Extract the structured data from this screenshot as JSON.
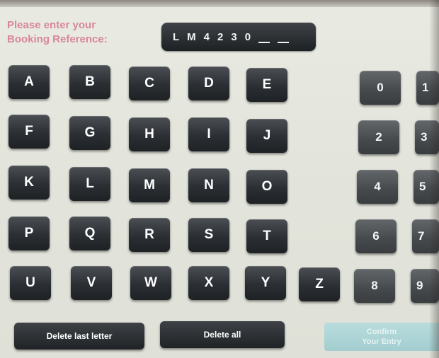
{
  "prompt": {
    "line1": "Please enter your",
    "line2": "Booking Reference:"
  },
  "reference": {
    "chars": [
      "L",
      "M",
      "4",
      "2",
      "3",
      "0"
    ],
    "remaining_blanks": 2
  },
  "letters": [
    [
      "A",
      "B",
      "C",
      "D",
      "E"
    ],
    [
      "F",
      "G",
      "H",
      "I",
      "J"
    ],
    [
      "K",
      "L",
      "M",
      "N",
      "O"
    ],
    [
      "P",
      "Q",
      "R",
      "S",
      "T"
    ],
    [
      "U",
      "V",
      "W",
      "X",
      "Y",
      "Z"
    ]
  ],
  "digits": {
    "left_column": [
      "0",
      "2",
      "4",
      "6",
      "8"
    ],
    "right_column_partial": [
      "1",
      "3",
      "5",
      "7",
      "9"
    ]
  },
  "actions": {
    "delete_last": "Delete last letter",
    "delete_all": "Delete all",
    "confirm_line1": "Confirm",
    "confirm_line2": "Your Entry"
  },
  "colors": {
    "prompt_text": "#d9869a",
    "key_dark": "#2b2f33",
    "confirm_disabled": "#a3cdd0"
  }
}
